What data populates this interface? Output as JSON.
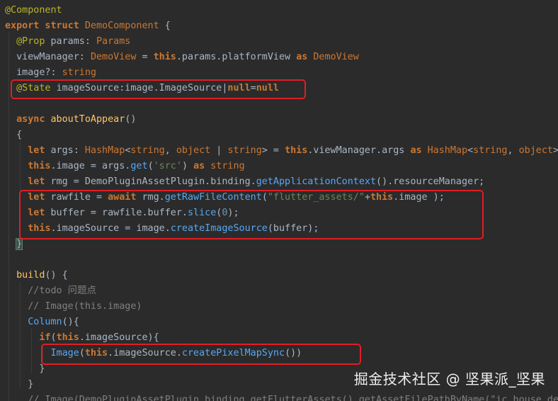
{
  "theme": {
    "background": "#2b2b2b",
    "keyword": "#cc7832",
    "type": "#cc7832",
    "function": "#ffc66d",
    "method": "#56a8f5",
    "string": "#6a8759",
    "number": "#6897bb",
    "comment": "#808080",
    "decorator": "#bbb529",
    "property": "#9876aa",
    "plain": "#a9b7c6",
    "highlight_box": "#e11d24"
  },
  "code_lines": [
    [
      [
        "@Component",
        "decorator"
      ]
    ],
    [
      [
        "export struct ",
        "keyword"
      ],
      [
        "DemoComponent",
        "type"
      ],
      [
        " {",
        "plain"
      ]
    ],
    [
      [
        "  ",
        "plain"
      ],
      [
        "@Prop",
        "decorator"
      ],
      [
        " params: ",
        "plain"
      ],
      [
        "Params",
        "type"
      ]
    ],
    [
      [
        "  viewManager: ",
        "plain"
      ],
      [
        "DemoView",
        "type"
      ],
      [
        " = ",
        "plain"
      ],
      [
        "this",
        "keyword"
      ],
      [
        ".params.platformView ",
        "plain"
      ],
      [
        "as ",
        "keyword"
      ],
      [
        "DemoView",
        "type"
      ]
    ],
    [
      [
        "  image?: ",
        "plain"
      ],
      [
        "string",
        "type"
      ]
    ],
    [
      [
        "  ",
        "plain"
      ],
      [
        "@State",
        "decorator"
      ],
      [
        " imageSource:image.ImageSource|",
        "plain"
      ],
      [
        "null",
        "keyword"
      ],
      [
        "=",
        "plain"
      ],
      [
        "null",
        "keyword"
      ]
    ],
    [],
    [
      [
        "  ",
        "plain"
      ],
      [
        "async ",
        "keyword"
      ],
      [
        "aboutToAppear",
        "function"
      ],
      [
        "()",
        "plain"
      ]
    ],
    [
      [
        "  {",
        "plain"
      ]
    ],
    [
      [
        "    ",
        "plain"
      ],
      [
        "let ",
        "keyword"
      ],
      [
        "args: ",
        "plain"
      ],
      [
        "HashMap",
        "type"
      ],
      [
        "<",
        "plain"
      ],
      [
        "string",
        "type"
      ],
      [
        ", ",
        "plain"
      ],
      [
        "object",
        "type"
      ],
      [
        " | ",
        "plain"
      ],
      [
        "string",
        "type"
      ],
      [
        "> = ",
        "plain"
      ],
      [
        "this",
        "keyword"
      ],
      [
        ".viewManager.args ",
        "plain"
      ],
      [
        "as ",
        "keyword"
      ],
      [
        "HashMap",
        "type"
      ],
      [
        "<",
        "plain"
      ],
      [
        "string",
        "type"
      ],
      [
        ", ",
        "plain"
      ],
      [
        "object",
        "type"
      ],
      [
        "> ",
        "plain"
      ]
    ],
    [
      [
        "    ",
        "plain"
      ],
      [
        "this",
        "keyword"
      ],
      [
        ".image = args.",
        "plain"
      ],
      [
        "get",
        "method"
      ],
      [
        "(",
        "plain"
      ],
      [
        "'src'",
        "string"
      ],
      [
        ") ",
        "plain"
      ],
      [
        "as ",
        "keyword"
      ],
      [
        "string",
        "type"
      ]
    ],
    [
      [
        "    ",
        "plain"
      ],
      [
        "let ",
        "keyword"
      ],
      [
        "rmg = DemoPluginAssetPlugin.binding.",
        "plain"
      ],
      [
        "getApplicationContext",
        "method"
      ],
      [
        "().resourceManager;",
        "plain"
      ]
    ],
    [
      [
        "    ",
        "plain"
      ],
      [
        "let ",
        "keyword"
      ],
      [
        "rawfile = ",
        "plain"
      ],
      [
        "await ",
        "keyword"
      ],
      [
        "rmg.",
        "plain"
      ],
      [
        "getRawFileContent",
        "method"
      ],
      [
        "(",
        "plain"
      ],
      [
        "\"flutter_assets/\"",
        "string"
      ],
      [
        "+",
        "plain"
      ],
      [
        "this",
        "keyword"
      ],
      [
        ".image );",
        "plain"
      ]
    ],
    [
      [
        "    ",
        "plain"
      ],
      [
        "let ",
        "keyword"
      ],
      [
        "buffer = rawfile.buffer.",
        "plain"
      ],
      [
        "slice",
        "method"
      ],
      [
        "(",
        "plain"
      ],
      [
        "0",
        "number"
      ],
      [
        ");",
        "plain"
      ]
    ],
    [
      [
        "    ",
        "plain"
      ],
      [
        "this",
        "keyword"
      ],
      [
        ".imageSource = image.",
        "plain"
      ],
      [
        "createImageSource",
        "method"
      ],
      [
        "(buffer);",
        "plain"
      ]
    ],
    [
      [
        "  ",
        "plain"
      ],
      [
        "}",
        "brace"
      ]
    ],
    [],
    [
      [
        "  ",
        "plain"
      ],
      [
        "build",
        "function"
      ],
      [
        "() {",
        "plain"
      ]
    ],
    [
      [
        "    ",
        "plain"
      ],
      [
        "//todo 问题点",
        "comment"
      ]
    ],
    [
      [
        "    ",
        "plain"
      ],
      [
        "// Image(this.image)",
        "comment"
      ]
    ],
    [
      [
        "    ",
        "plain"
      ],
      [
        "Column",
        "method"
      ],
      [
        "(){",
        "plain"
      ]
    ],
    [
      [
        "      ",
        "plain"
      ],
      [
        "if",
        "keyword"
      ],
      [
        "(",
        "plain"
      ],
      [
        "this",
        "keyword"
      ],
      [
        ".imageSource){",
        "plain"
      ]
    ],
    [
      [
        "        ",
        "plain"
      ],
      [
        "Image",
        "method"
      ],
      [
        "(",
        "plain"
      ],
      [
        "this",
        "keyword"
      ],
      [
        ".imageSource.",
        "plain"
      ],
      [
        "createPixelMapSync",
        "method"
      ],
      [
        "())",
        "plain"
      ]
    ],
    [
      [
        "      }",
        "plain"
      ]
    ],
    [
      [
        "    }",
        "plain"
      ]
    ],
    [
      [
        "    ",
        "plain"
      ],
      [
        "// Image(DemoPluginAssetPlugin.binding.getFlutterAssets().getAssetFilePathByName(\"ic_house_def",
        "comment"
      ]
    ]
  ],
  "watermark": "掘金技术社区 @ 坚果派_坚果"
}
